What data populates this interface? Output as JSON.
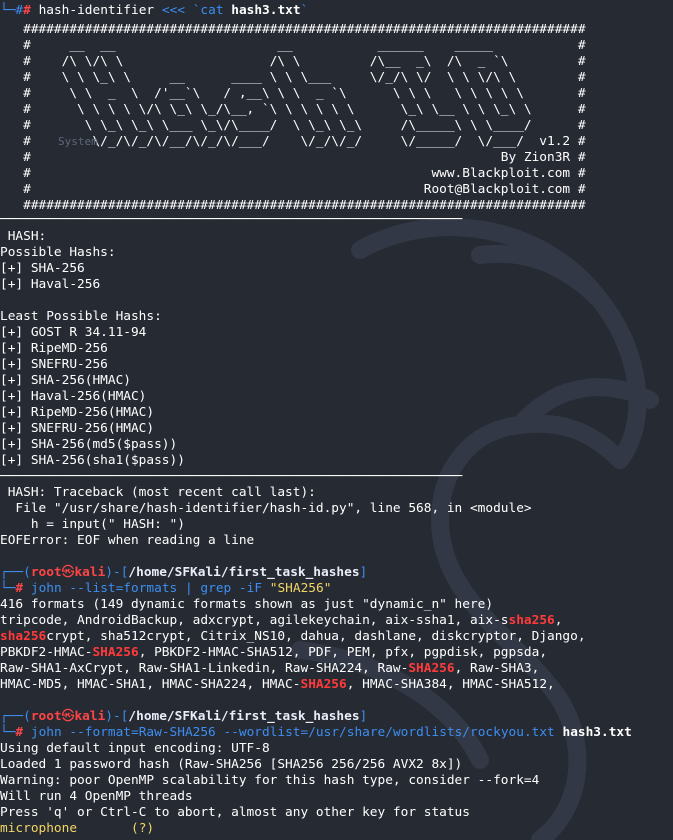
{
  "colors": {
    "background": "#262a33",
    "prompt_accent": "#3d8ef0",
    "root_red": "#ff4545",
    "highlight_red": "#ff3b3b",
    "text": "#ffffff"
  },
  "first_command": {
    "prompt_arrow": "└─#",
    "command": "hash-identifier",
    "operator": "<<<",
    "arg_pre": "`cat ",
    "file": "hash3.txt",
    "arg_post": "`"
  },
  "banner": {
    "lines": [
      "   #########################################################################",
      "   #     __  __                     __           ______    _____           #",
      "   #    /\\ \\/\\ \\                   /\\ \\         /\\__  _\\  /\\  _ `\\         #",
      "   #    \\ \\ \\_\\ \\     __      ____ \\ \\ \\___     \\/_/\\ \\/  \\ \\ \\/\\ \\        #",
      "   #     \\ \\  _  \\  /'__`\\   / ,__\\ \\ \\  _ `\\      \\ \\ \\   \\ \\ \\ \\ \\       #",
      "   #      \\ \\ \\ \\ \\/\\ \\_\\ \\_/\\__, `\\ \\ \\ \\ \\ \\      \\_\\ \\__ \\ \\ \\_\\ \\      #",
      "   #       \\ \\_\\ \\_\\ \\___ \\_\\/\\____/  \\ \\_\\ \\_\\     /\\_____\\ \\ \\____/      #",
      "   #        \\/_/\\/_/\\/__/\\/_/\\/___/    \\/_/\\/_/     \\/_____/  \\/___/  v1.2 #",
      "   #                                                             By Zion3R #",
      "   #                                                    www.Blackploit.com #",
      "   #                                                   Root@Blackploit.com #",
      "   #########################################################################"
    ],
    "faded_label": "System"
  },
  "hash_output": {
    "separator": "────────────────────────────────────────────────────────────",
    "label": " HASH:",
    "possible_title": "Possible Hashs:",
    "possible": [
      "[+] SHA-256",
      "[+] Haval-256"
    ],
    "least_title": "Least Possible Hashs:",
    "least": [
      "[+] GOST R 34.11-94",
      "[+] RipeMD-256",
      "[+] SNEFRU-256",
      "[+] SHA-256(HMAC)",
      "[+] Haval-256(HMAC)",
      "[+] RipeMD-256(HMAC)",
      "[+] SNEFRU-256(HMAC)",
      "[+] SHA-256(md5($pass))",
      "[+] SHA-256(sha1($pass))"
    ]
  },
  "traceback": {
    "lines": [
      " HASH: Traceback (most recent call last):",
      "  File \"/usr/share/hash-identifier/hash-id.py\", line 568, in <module>",
      "    h = input(\" HASH: \")",
      "EOFError: EOF when reading a line"
    ]
  },
  "prompt": {
    "corner_top": "┌──(",
    "user": "root",
    "at": "㉿",
    "host": "kali",
    "mid": ")-[",
    "path": "/home/SFKali/first_task_hashes",
    "end": "]",
    "corner_bottom": "└─",
    "hash": "#"
  },
  "john_formats": {
    "command": "john --list=formats",
    "pipe": "|",
    "grep": "grep -iF",
    "pattern": "\"SHA256\"",
    "lines": [
      [
        {
          "t": "416 formats (149 dynamic formats shown as just \"dynamic_n\" here)"
        }
      ],
      [
        {
          "t": "tripcode, AndroidBackup, adxcrypt, agilekeychain, aix-ssha1, aix-s"
        },
        {
          "t": "sha256",
          "h": true
        },
        {
          "t": ","
        }
      ],
      [
        {
          "t": "sha256",
          "h": true
        },
        {
          "t": "crypt, sha512crypt, Citrix_NS10, dahua, dashlane, diskcryptor, Django,"
        }
      ],
      [
        {
          "t": "PBKDF2-HMAC-"
        },
        {
          "t": "SHA256",
          "h": true
        },
        {
          "t": ", PBKDF2-HMAC-SHA512, PDF, PEM, pfx, pgpdisk, pgpsda,"
        }
      ],
      [
        {
          "t": "Raw-SHA1-AxCrypt, Raw-SHA1-Linkedin, Raw-SHA224, Raw-"
        },
        {
          "t": "SHA256",
          "h": true
        },
        {
          "t": ", Raw-SHA3,"
        }
      ],
      [
        {
          "t": "HMAC-MD5, HMAC-SHA1, HMAC-SHA224, HMAC-"
        },
        {
          "t": "SHA256",
          "h": true
        },
        {
          "t": ", HMAC-SHA384, HMAC-SHA512,"
        }
      ]
    ]
  },
  "john_crack": {
    "command": "john --format=Raw-SHA256 --wordlist=/usr/share/wordlists/rockyou.txt",
    "file": "hash3.txt",
    "lines": [
      "Using default input encoding: UTF-8",
      "Loaded 1 password hash (Raw-SHA256 [SHA256 256/256 AVX2 8x])",
      "Warning: poor OpenMP scalability for this hash type, consider --fork=4",
      "Will run 4 OpenMP threads",
      "Press 'q' or Ctrl-C to abort, almost any other key for status"
    ],
    "result_word": "microphone",
    "result_user": "(?)"
  }
}
